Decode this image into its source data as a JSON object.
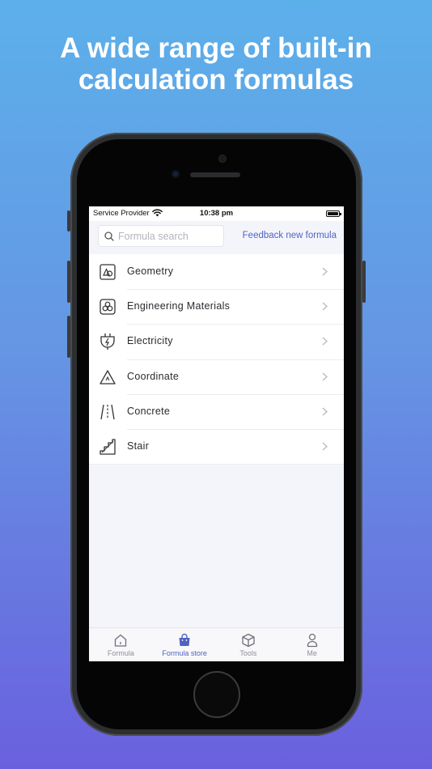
{
  "headline": {
    "line1": "A wide range of built-in",
    "line2": "calculation formulas"
  },
  "status_bar": {
    "carrier": "Service Provider",
    "time": "10:38 pm"
  },
  "search": {
    "placeholder": "Formula search",
    "value": ""
  },
  "feedback_label": "Feedback new formula",
  "categories": [
    {
      "label": "Geometry",
      "icon": "geometry-icon"
    },
    {
      "label": "Engineering Materials",
      "icon": "materials-icon"
    },
    {
      "label": "Electricity",
      "icon": "electricity-plug-icon"
    },
    {
      "label": "Coordinate",
      "icon": "coordinate-triangle-icon"
    },
    {
      "label": "Concrete",
      "icon": "road-lanes-icon"
    },
    {
      "label": "Stair",
      "icon": "stair-icon"
    }
  ],
  "tabs": [
    {
      "label": "Formula",
      "icon": "home-icon",
      "active": false
    },
    {
      "label": "Formula store",
      "icon": "shopping-bag-icon",
      "active": true
    },
    {
      "label": "Tools",
      "icon": "cube-icon",
      "active": false
    },
    {
      "label": "Me",
      "icon": "user-icon",
      "active": false
    }
  ],
  "colors": {
    "accent": "#4f62c4",
    "background_top": "#5cb0ea",
    "background_bottom": "#6a60de"
  }
}
